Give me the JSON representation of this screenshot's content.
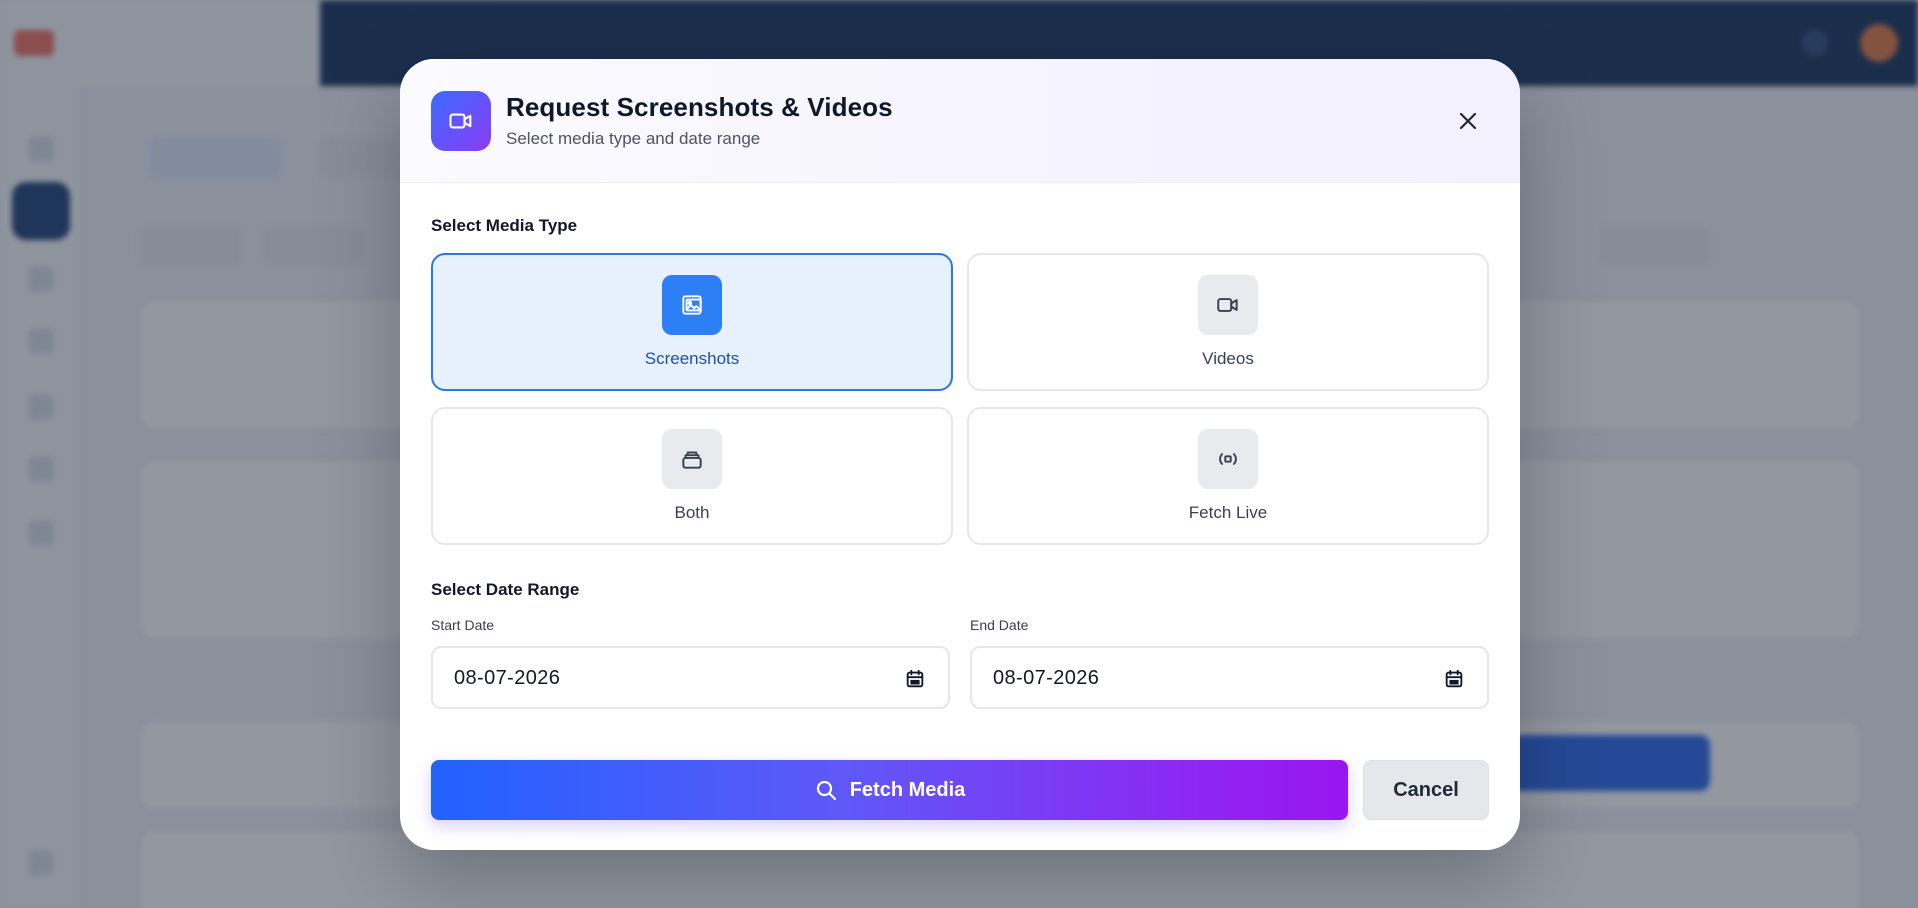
{
  "modal": {
    "title": "Request Screenshots & Videos",
    "subtitle": "Select media type and date range",
    "header_icon": "video-camera-icon",
    "close_icon": "close-icon"
  },
  "media_type": {
    "label": "Select Media Type",
    "options": [
      {
        "label": "Screenshots",
        "icon": "image-icon",
        "selected": true
      },
      {
        "label": "Videos",
        "icon": "video-camera-icon",
        "selected": false
      },
      {
        "label": "Both",
        "icon": "stack-icon",
        "selected": false
      },
      {
        "label": "Fetch Live",
        "icon": "live-broadcast-icon",
        "selected": false
      }
    ]
  },
  "date_range": {
    "label": "Select Date Range",
    "start": {
      "label": "Start Date",
      "value": "08-07-2026"
    },
    "end": {
      "label": "End Date",
      "value": "08-07-2026"
    }
  },
  "actions": {
    "fetch_label": "Fetch Media",
    "fetch_icon": "search-icon",
    "cancel_label": "Cancel"
  },
  "colors": {
    "accent_blue": "#2d7ff5",
    "gradient_start": "#2162ff",
    "gradient_end": "#9a15f0",
    "selected_bg": "#e7f1fd"
  }
}
